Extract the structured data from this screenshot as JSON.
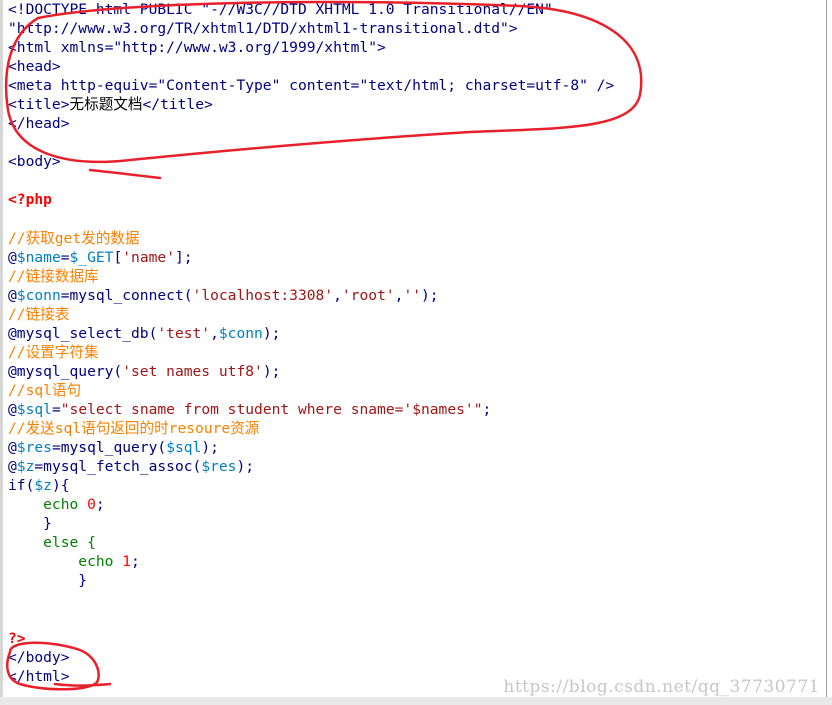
{
  "editor": {
    "lines": [
      [
        {
          "t": "<!DOCTYPE html PUBLIC \"-//W3C//DTD XHTML 1.0 Transitional//EN\"",
          "c": "c-black"
        }
      ],
      [
        {
          "t": "\"http://www.w3.org/TR/xhtml1/DTD/xhtml1-transitional.dtd\">",
          "c": "c-black"
        }
      ],
      [
        {
          "t": "<html xmlns=\"http://www.w3.org/1999/xhtml\">",
          "c": "c-black"
        }
      ],
      [
        {
          "t": "<head>",
          "c": "c-black"
        }
      ],
      [
        {
          "t": "<meta http-equiv=\"Content-Type\" content=\"text/html; charset=utf-8\" />",
          "c": "c-black"
        }
      ],
      [
        {
          "t": "<title>",
          "c": "c-black"
        },
        {
          "t": "无标题文档",
          "c": "c-txt"
        },
        {
          "t": "</title>",
          "c": "c-black"
        }
      ],
      [
        {
          "t": "</head>",
          "c": "c-black"
        }
      ],
      [
        {
          "t": "",
          "c": "c-black"
        }
      ],
      [
        {
          "t": "<body>",
          "c": "c-black"
        }
      ],
      [
        {
          "t": "",
          "c": "c-black"
        }
      ],
      [
        {
          "t": "<?php",
          "c": "c-red"
        }
      ],
      [
        {
          "t": "",
          "c": "c-black"
        }
      ],
      [
        {
          "t": "//获取get发的数据",
          "c": "c-cmt"
        }
      ],
      [
        {
          "t": "@",
          "c": "c-fn"
        },
        {
          "t": "$name",
          "c": "c-var"
        },
        {
          "t": "=",
          "c": "c-fn"
        },
        {
          "t": "$_GET",
          "c": "c-var"
        },
        {
          "t": "[",
          "c": "c-fn"
        },
        {
          "t": "'name'",
          "c": "c-str"
        },
        {
          "t": "];",
          "c": "c-fn"
        }
      ],
      [
        {
          "t": "//链接数据库",
          "c": "c-cmt"
        }
      ],
      [
        {
          "t": "@",
          "c": "c-fn"
        },
        {
          "t": "$conn",
          "c": "c-var"
        },
        {
          "t": "=mysql_connect(",
          "c": "c-fn"
        },
        {
          "t": "'localhost:3308'",
          "c": "c-str"
        },
        {
          "t": ",",
          "c": "c-fn"
        },
        {
          "t": "'root'",
          "c": "c-str"
        },
        {
          "t": ",",
          "c": "c-fn"
        },
        {
          "t": "''",
          "c": "c-str"
        },
        {
          "t": ");",
          "c": "c-fn"
        }
      ],
      [
        {
          "t": "//链接表",
          "c": "c-cmt"
        }
      ],
      [
        {
          "t": "@mysql_select_db(",
          "c": "c-fn"
        },
        {
          "t": "'test'",
          "c": "c-str"
        },
        {
          "t": ",",
          "c": "c-fn"
        },
        {
          "t": "$conn",
          "c": "c-var"
        },
        {
          "t": ");",
          "c": "c-fn"
        }
      ],
      [
        {
          "t": "//设置字符集",
          "c": "c-cmt"
        }
      ],
      [
        {
          "t": "@mysql_query(",
          "c": "c-fn"
        },
        {
          "t": "'set names utf8'",
          "c": "c-str"
        },
        {
          "t": ");",
          "c": "c-fn"
        }
      ],
      [
        {
          "t": "//sql语句",
          "c": "c-cmt"
        }
      ],
      [
        {
          "t": "@",
          "c": "c-fn"
        },
        {
          "t": "$sql",
          "c": "c-var"
        },
        {
          "t": "=",
          "c": "c-fn"
        },
        {
          "t": "\"select sname from student where sname='$names'\"",
          "c": "c-str"
        },
        {
          "t": ";",
          "c": "c-fn"
        }
      ],
      [
        {
          "t": "//发送sql语句返回的时resoure资源",
          "c": "c-cmt"
        }
      ],
      [
        {
          "t": "@",
          "c": "c-fn"
        },
        {
          "t": "$res",
          "c": "c-var"
        },
        {
          "t": "=mysql_query(",
          "c": "c-fn"
        },
        {
          "t": "$sql",
          "c": "c-var"
        },
        {
          "t": ");",
          "c": "c-fn"
        }
      ],
      [
        {
          "t": "@",
          "c": "c-fn"
        },
        {
          "t": "$z",
          "c": "c-var"
        },
        {
          "t": "=mysql_fetch_assoc(",
          "c": "c-fn"
        },
        {
          "t": "$res",
          "c": "c-var"
        },
        {
          "t": ");",
          "c": "c-fn"
        }
      ],
      [
        {
          "t": "if(",
          "c": "c-fn"
        },
        {
          "t": "$z",
          "c": "c-var"
        },
        {
          "t": "){",
          "c": "c-fn"
        }
      ],
      [
        {
          "t": "    echo ",
          "c": "c-kw"
        },
        {
          "t": "0",
          "c": "c-num"
        },
        {
          "t": ";",
          "c": "c-fn"
        }
      ],
      [
        {
          "t": "    }",
          "c": "c-fn"
        }
      ],
      [
        {
          "t": "    else {",
          "c": "c-kw"
        }
      ],
      [
        {
          "t": "        echo ",
          "c": "c-kw"
        },
        {
          "t": "1",
          "c": "c-num"
        },
        {
          "t": ";",
          "c": "c-fn"
        }
      ],
      [
        {
          "t": "        }",
          "c": "c-fn"
        }
      ],
      [
        {
          "t": "",
          "c": "c-black"
        }
      ],
      [
        {
          "t": "",
          "c": "c-black"
        }
      ],
      [
        {
          "t": "?>",
          "c": "c-red"
        }
      ],
      [
        {
          "t": "</body>",
          "c": "c-black"
        }
      ],
      [
        {
          "t": "</html>",
          "c": "c-black"
        }
      ]
    ]
  },
  "watermark": "https://blog.csdn.net/qq_37730771",
  "colors": {
    "annotation": "#e8202a"
  }
}
